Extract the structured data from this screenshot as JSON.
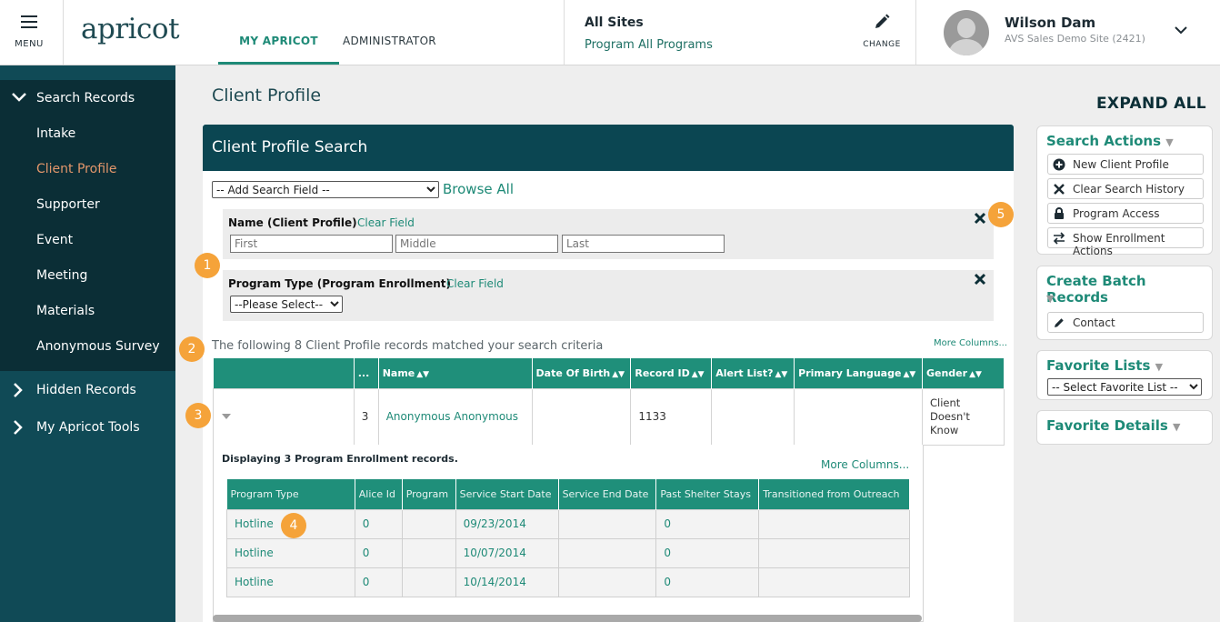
{
  "header": {
    "menu_label": "MENU",
    "logo": "apricot",
    "tabs": [
      "MY APRICOT",
      "ADMINISTRATOR"
    ],
    "site_title": "All Sites",
    "site_program": "Program All Programs",
    "change_label": "CHANGE",
    "user_name": "Wilson Dam",
    "user_site": "AVS Sales Demo Site (2421)"
  },
  "sidebar": {
    "group1": "Search Records",
    "items": [
      "Intake",
      "Client Profile",
      "Supporter",
      "Event",
      "Meeting",
      "Materials",
      "Anonymous Survey"
    ],
    "group2": "Hidden Records",
    "group3": "My Apricot Tools"
  },
  "main": {
    "page_title": "Client Profile",
    "expand_all": "EXPAND ALL",
    "panel_title": "Client Profile Search",
    "add_field_select": "-- Add Search Field --",
    "browse_all": "Browse All",
    "name_field": {
      "label": "Name (Client Profile)",
      "clear": "Clear Field",
      "first_ph": "First",
      "middle_ph": "Middle",
      "last_ph": "Last"
    },
    "program_field": {
      "label": "Program Type (Program Enrollment)",
      "clear": "Clear Field",
      "select": "--Please Select--"
    },
    "matched_text": "The following 8 Client Profile records matched your search criteria",
    "more_columns": "More Columns...",
    "results_headers": [
      "",
      "...",
      "Name",
      "Date Of Birth",
      "Record ID",
      "Alert List?",
      "Primary Language",
      "Gender"
    ],
    "results_row": {
      "count": "3",
      "name": "Anonymous Anonymous",
      "dob": "",
      "record_id": "1133",
      "alert": "",
      "language": "",
      "gender": "Client Doesn't Know"
    },
    "sub_title": "Displaying 3 Program Enrollment records.",
    "sub_more_columns": "More Columns...",
    "sub_headers": [
      "Program Type",
      "Alice Id",
      "Program",
      "Service Start Date",
      "Service End Date",
      "Past Shelter Stays",
      "Transitioned from Outreach"
    ],
    "sub_rows": [
      [
        "Hotline",
        "0",
        "",
        "09/23/2014",
        "",
        "0",
        ""
      ],
      [
        "Hotline",
        "0",
        "",
        "10/07/2014",
        "",
        "0",
        ""
      ],
      [
        "Hotline",
        "0",
        "",
        "10/14/2014",
        "",
        "0",
        ""
      ]
    ],
    "badges": [
      "1",
      "2",
      "3",
      "4",
      "5"
    ]
  },
  "right": {
    "search_actions": "Search Actions",
    "actions": [
      "New Client Profile",
      "Clear Search History",
      "Program Access",
      "Show Enrollment Actions"
    ],
    "batch": "Create Batch Records",
    "batch_item": "Contact",
    "fav_lists": "Favorite Lists",
    "fav_select": "-- Select Favorite List --",
    "fav_details": "Favorite Details"
  },
  "colors": {
    "teal": "#1f8f7a",
    "navy": "#0b4652",
    "accent": "#e2966b",
    "badge": "#f5a33a"
  }
}
